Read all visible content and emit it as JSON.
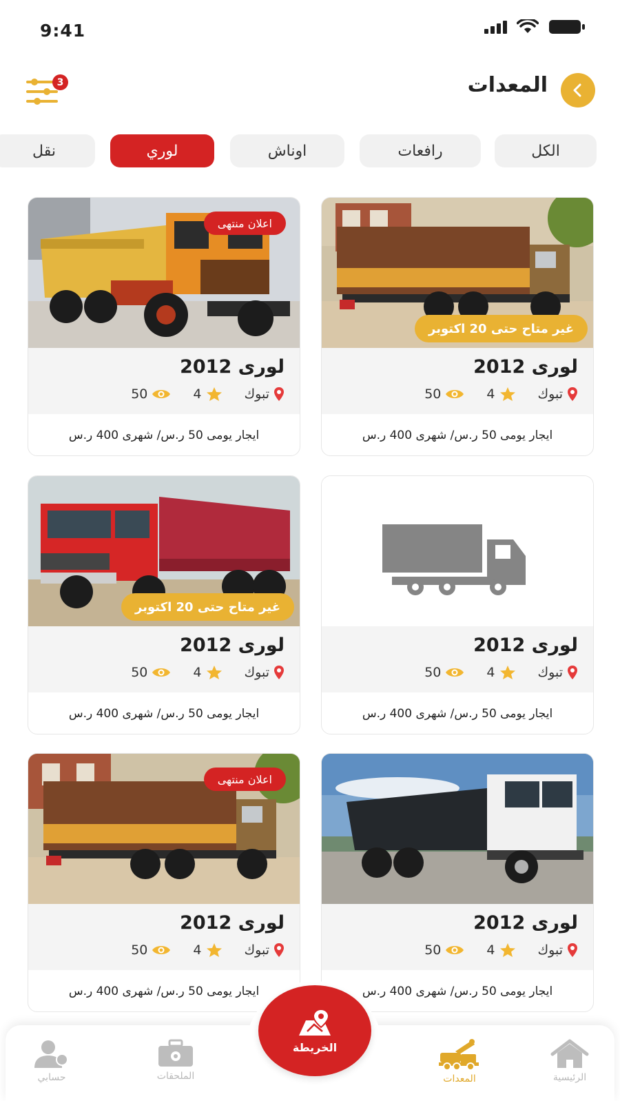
{
  "status_bar": {
    "time": "9:41"
  },
  "header": {
    "title": "المعدات",
    "filter_count": "3"
  },
  "tabs": [
    {
      "label": "الكل",
      "active": false
    },
    {
      "label": "رافعات",
      "active": false
    },
    {
      "label": "اوناش",
      "active": false
    },
    {
      "label": "لوري",
      "active": true
    },
    {
      "label": "نقل",
      "active": false
    }
  ],
  "cards": [
    {
      "title": "لورى 2012",
      "location": "تبوك",
      "rating": "4",
      "views": "50",
      "price": "ايجار يومى 50 ر.س/ شهرى 400 ر.س",
      "badge": "غير متاح  حتى 20 اكتوبر",
      "badge_type": "yellow",
      "image": "truck-covered-brown"
    },
    {
      "title": "لورى 2012",
      "location": "تبوك",
      "rating": "4",
      "views": "50",
      "price": "ايجار يومى 50 ر.س/ شهرى 400 ر.س",
      "badge": "اعلان منتهى",
      "badge_type": "red",
      "image": "truck-orange-dump"
    },
    {
      "title": "لورى 2012",
      "location": "تبوك",
      "rating": "4",
      "views": "50",
      "price": "ايجار يومى 50 ر.س/ شهرى 400 ر.س",
      "badge": "",
      "badge_type": "none",
      "image": "truck-placeholder-icon"
    },
    {
      "title": "لورى 2012",
      "location": "تبوك",
      "rating": "4",
      "views": "50",
      "price": "ايجار يومى 50 ر.س/ شهرى 400 ر.س",
      "badge": "غير متاح  حتى 20 اكتوبر",
      "badge_type": "yellow",
      "image": "truck-red-dump"
    },
    {
      "title": "لورى 2012",
      "location": "تبوك",
      "rating": "4",
      "views": "50",
      "price": "ايجار يومى 50 ر.س/ شهرى 400 ر.س",
      "badge": "",
      "badge_type": "none",
      "image": "truck-black-white-dump"
    },
    {
      "title": "لورى 2012",
      "location": "تبوك",
      "rating": "4",
      "views": "50",
      "price": "ايجار يومى 50 ر.س/ شهرى 400 ر.س",
      "badge": "اعلان منتهى",
      "badge_type": "red",
      "image": "truck-covered-brown"
    }
  ],
  "bottom_nav": {
    "home": "الرئيسية",
    "equipment": "المعدات",
    "map": "الخريطة",
    "accessories": "الملحقات",
    "account": "حسابي"
  },
  "colors": {
    "accent_yellow": "#e9b233",
    "accent_red": "#d42323",
    "inactive": "#b8b8b8"
  }
}
